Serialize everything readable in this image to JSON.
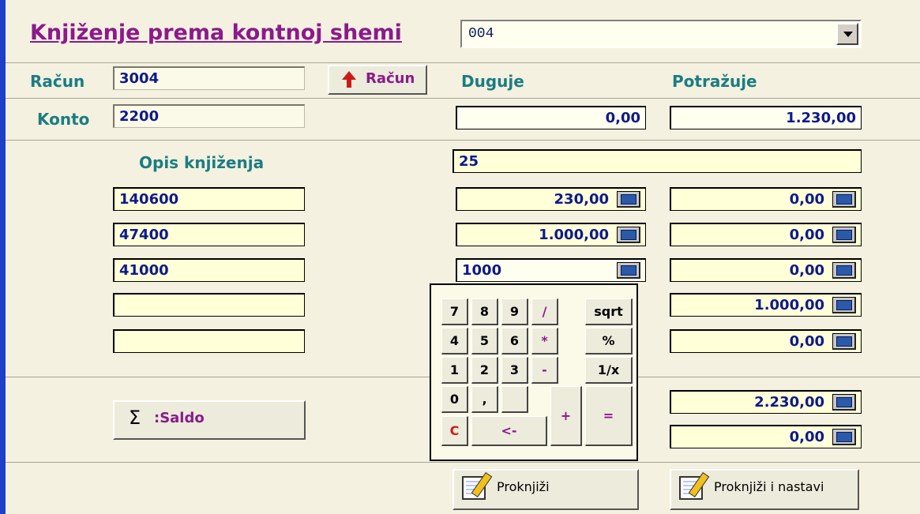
{
  "header": {
    "title": "Knjiženje prema kontnoj shemi",
    "scheme_value": "004"
  },
  "racun": {
    "label": "Račun",
    "value": "3004",
    "button_label": "Račun"
  },
  "konto": {
    "label": "Konto",
    "value": "2200"
  },
  "columns": {
    "duguje": "Duguje",
    "potrazuje": "Potražuje"
  },
  "totals_top": {
    "duguje": "0,00",
    "potrazuje": "1.230,00"
  },
  "opis": {
    "label": "Opis knjiženja",
    "value": "25"
  },
  "rows": [
    {
      "konto": "140600",
      "duguje": "230,00",
      "potrazuje": "0,00"
    },
    {
      "konto": "47400",
      "duguje": "1.000,00",
      "potrazuje": "0,00"
    },
    {
      "konto": "41000",
      "duguje": "1000",
      "potrazuje": "0,00"
    },
    {
      "konto": "",
      "duguje": "",
      "potrazuje": "1.000,00"
    },
    {
      "konto": "",
      "duguje": "",
      "potrazuje": "0,00"
    }
  ],
  "saldo": {
    "button_label": ":Saldo",
    "sigma": "Σ",
    "total": "2.230,00",
    "difference": "0,00"
  },
  "calculator": {
    "keys": [
      "7",
      "8",
      "9",
      "/",
      "sqrt",
      "4",
      "5",
      "6",
      "*",
      "%",
      "1",
      "2",
      "3",
      "-",
      "1/x",
      "0",
      ",",
      "+",
      "=",
      "C",
      "<-"
    ]
  },
  "actions": {
    "post": "Proknjiži",
    "post_continue": "Proknjiži i nastavi"
  }
}
